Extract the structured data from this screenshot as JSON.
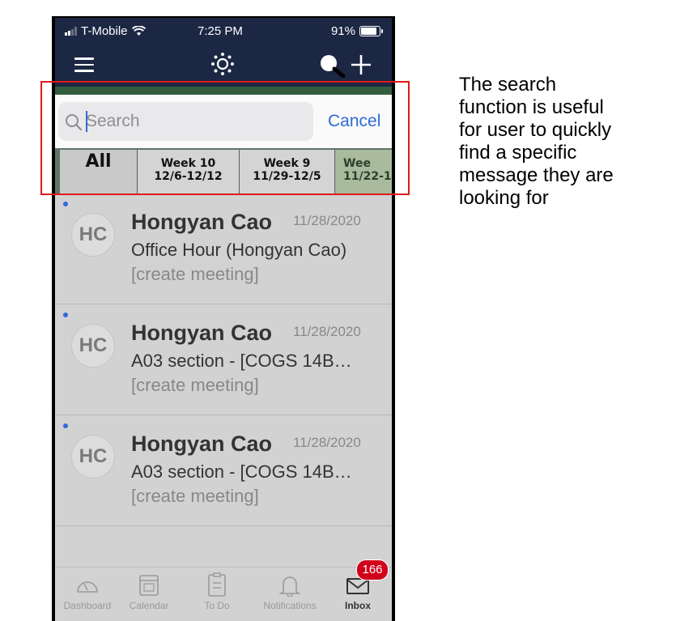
{
  "status_bar": {
    "carrier": "T-Mobile",
    "time": "7:25 PM",
    "battery": "91%"
  },
  "search": {
    "placeholder": "Search",
    "value": "",
    "cancel_label": "Cancel"
  },
  "tabs": [
    {
      "label": "All"
    },
    {
      "label": "Week 10",
      "range": "12/6-12/12"
    },
    {
      "label": "Week 9",
      "range": "11/29-12/5"
    },
    {
      "label": "Wee",
      "range": "11/22-1"
    }
  ],
  "messages": [
    {
      "initials": "HC",
      "sender": "Hongyan Cao",
      "date": "11/28/2020",
      "subject": "Office Hour (Hongyan Cao)",
      "preview": "[create meeting]",
      "unread": true
    },
    {
      "initials": "HC",
      "sender": "Hongyan Cao",
      "date": "11/28/2020",
      "subject": "A03 section - [COGS 14B…",
      "preview": "[create meeting]",
      "unread": true
    },
    {
      "initials": "HC",
      "sender": "Hongyan Cao",
      "date": "11/28/2020",
      "subject": "A03 section - [COGS 14B…",
      "preview": "[create meeting]",
      "unread": true
    }
  ],
  "tabbar": [
    {
      "label": "Dashboard",
      "icon": "dashboard-icon"
    },
    {
      "label": "Calendar",
      "icon": "calendar-icon"
    },
    {
      "label": "To Do",
      "icon": "todo-icon"
    },
    {
      "label": "Notifications",
      "icon": "bell-icon"
    },
    {
      "label": "Inbox",
      "icon": "inbox-icon",
      "badge": "166",
      "active": true
    }
  ],
  "annotation": "The search\nfunction is useful\nfor user to quickly\nfind a specific\nmessage they are\nlooking for",
  "colors": {
    "nav_bg": "#1c2744",
    "accent_blue": "#2f6bd8",
    "highlight_red": "#e0191e",
    "badge_red": "#d0021b"
  }
}
